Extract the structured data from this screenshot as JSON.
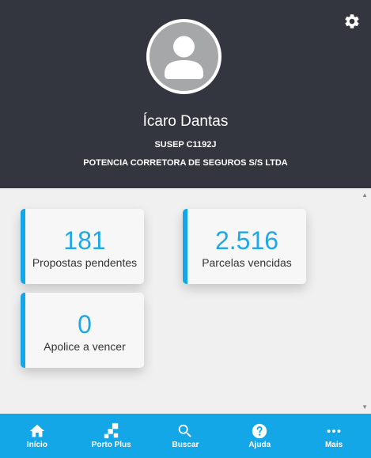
{
  "header": {
    "user_name": "Ícaro Dantas",
    "susep": "SUSEP C1192J",
    "company": "POTENCIA CORRETORA DE SEGUROS S/S LTDA",
    "settings_icon": "gear-icon",
    "avatar_icon": "user-avatar-icon"
  },
  "cards": [
    {
      "value": "181",
      "label": "Propostas pendentes"
    },
    {
      "value": "2.516",
      "label": "Parcelas vencidas"
    },
    {
      "value": "0",
      "label": "Apolice a vencer"
    }
  ],
  "nav": [
    {
      "label": "Início",
      "icon": "home-icon"
    },
    {
      "label": "Porto Plus",
      "icon": "porto-plus-icon"
    },
    {
      "label": "Buscar",
      "icon": "search-icon"
    },
    {
      "label": "Ajuda",
      "icon": "help-icon"
    },
    {
      "label": "Mais",
      "icon": "more-icon"
    }
  ],
  "colors": {
    "header_bg": "#33363f",
    "accent": "#13a7e8",
    "value_text": "#1ea8e4",
    "content_bg": "#f0f0f0"
  }
}
